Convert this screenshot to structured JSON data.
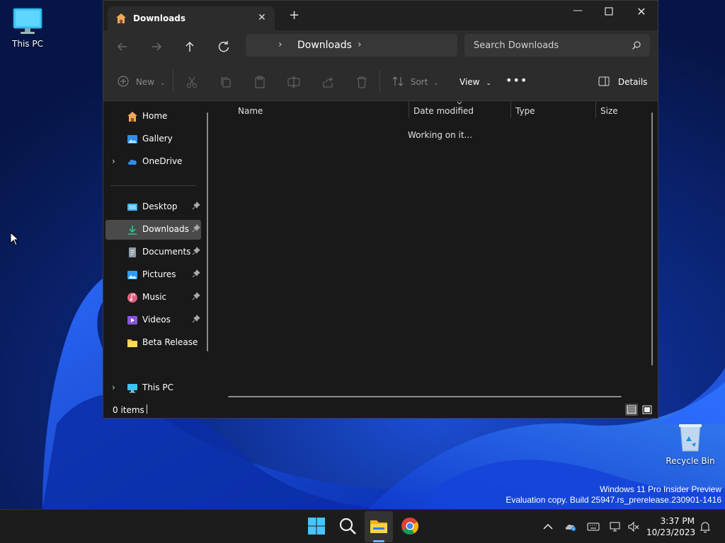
{
  "desktop": {
    "icons": [
      {
        "label": "This PC"
      },
      {
        "label": "Recycle Bin"
      }
    ],
    "watermark": {
      "line1": "Windows 11 Pro Insider Preview",
      "line2": "Evaluation copy. Build 25947.rs_prerelease.230901-1416"
    }
  },
  "explorer": {
    "tab": {
      "title": "Downloads"
    },
    "address": {
      "path": "Downloads"
    },
    "search": {
      "placeholder": "Search Downloads"
    },
    "toolbar": {
      "new_label": "New",
      "sort_label": "Sort",
      "view_label": "View",
      "details_label": "Details"
    },
    "sidebar": {
      "items": [
        {
          "label": "Home"
        },
        {
          "label": "Gallery"
        },
        {
          "label": "OneDrive"
        },
        {
          "label": "Desktop"
        },
        {
          "label": "Downloads"
        },
        {
          "label": "Documents"
        },
        {
          "label": "Pictures"
        },
        {
          "label": "Music"
        },
        {
          "label": "Videos"
        },
        {
          "label": "Beta Release"
        },
        {
          "label": "This PC"
        }
      ],
      "selected": "Downloads"
    },
    "columns": [
      "Name",
      "Date modified",
      "Type",
      "Size"
    ],
    "loading_text": "Working on it...",
    "status": {
      "item_count": "0 items"
    }
  },
  "taskbar": {
    "clock": {
      "time": "3:37 PM",
      "date": "10/23/2023"
    }
  },
  "colors": {
    "accent": "#6cb4ff",
    "window_bg": "#191919",
    "chrome_bg": "#2c2c2c",
    "selected_bg": "#4a4a4a"
  }
}
